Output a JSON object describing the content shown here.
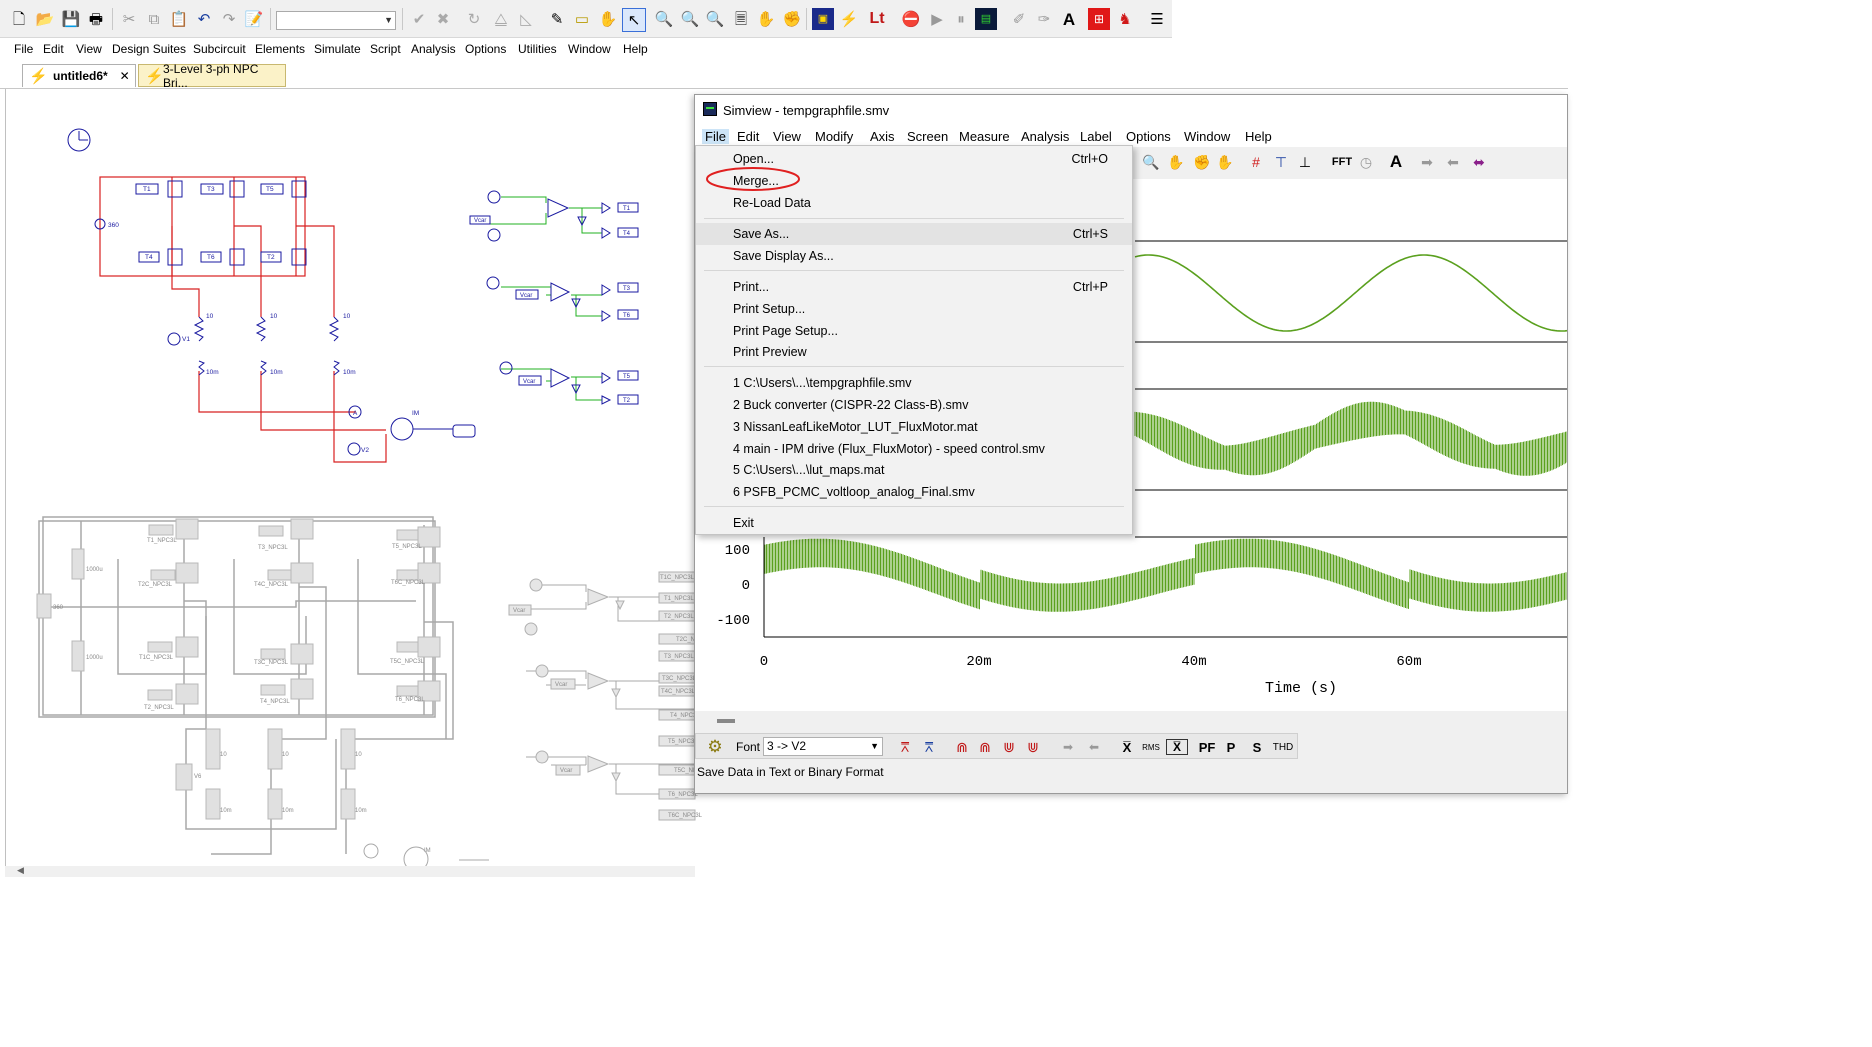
{
  "main_window": {
    "menus": [
      "File",
      "Edit",
      "View",
      "Design Suites",
      "Subcircuit",
      "Elements",
      "Simulate",
      "Script",
      "Analysis",
      "Options",
      "Utilities",
      "Window",
      "Help"
    ],
    "tabs": [
      {
        "label": "untitled6*",
        "close": "✕"
      },
      {
        "label": "3-Level 3-ph NPC Bri..."
      }
    ],
    "toolbar_icons": [
      "new-file",
      "open-folder",
      "save",
      "print",
      "cut",
      "copy",
      "paste",
      "undo",
      "redo",
      "clipboard",
      "check",
      "cross",
      "rotate",
      "flip",
      "mirror",
      "pencil",
      "label",
      "hand",
      "select-arrow",
      "zoom",
      "zoom-in",
      "zoom-out",
      "page",
      "hand-pan",
      "hand-grab",
      "simview",
      "wand",
      "lt",
      "stop",
      "run",
      "pause",
      "scope",
      "pen-probe",
      "pen-probe2",
      "text",
      "plot-icon",
      "redbull-icon",
      "list"
    ]
  },
  "schematic": {
    "labels": {
      "dc_source": "360",
      "dc_source2": "360",
      "sw": [
        "T1",
        "T3",
        "T5",
        "T4",
        "T6",
        "T2"
      ],
      "r": "10",
      "l": "10m",
      "v1": "V1",
      "v2": "V2",
      "im": "IM",
      "a": "A",
      "vcar": "Vcar",
      "g_out": [
        "T1",
        "T4",
        "T3",
        "T6",
        "T5",
        "T2"
      ],
      "npc_sw": [
        "T1_NPC3L",
        "T3_NPC3L",
        "T5_NPC3L",
        "T2C_NPC3L",
        "T4C_NPC3L",
        "T6C_NPC3L",
        "T1C_NPC3L",
        "T3C_NPC3L",
        "T5C_NPC3L",
        "T2_NPC3L",
        "T4_NPC3L",
        "T6_NPC3L"
      ],
      "cap": "1000u",
      "v6": "V6",
      "npc_g": [
        "T1C_NPC3L",
        "T1_NPC3L",
        "T2_NPC3L",
        "T2C_NPC3L",
        "T3_NPC3L",
        "T3C_NPC3L",
        "T4C_NPC3L",
        "T4_NPC3L",
        "T5_NPC3L",
        "T5C_NPC3L",
        "T6_NPC3L",
        "T6C_NPC3L"
      ]
    }
  },
  "simview": {
    "title": "Simview - tempgraphfile.smv",
    "menus": [
      "File",
      "Edit",
      "View",
      "Modify",
      "Axis",
      "Screen",
      "Measure",
      "Analysis",
      "Label",
      "Options",
      "Window",
      "Help"
    ],
    "toolbar_labels": {
      "fft": "FFT",
      "text": "A"
    },
    "file_menu": {
      "items": [
        {
          "label": "Open...",
          "shortcut": "Ctrl+O"
        },
        {
          "label": "Merge...",
          "shortcut": ""
        },
        {
          "label": "Re-Load Data",
          "shortcut": ""
        },
        {
          "label": "Save As...",
          "shortcut": "Ctrl+S"
        },
        {
          "label": "Save Display As...",
          "shortcut": ""
        },
        {
          "label": "Print...",
          "shortcut": "Ctrl+P"
        },
        {
          "label": "Print Setup...",
          "shortcut": ""
        },
        {
          "label": "Print Page Setup...",
          "shortcut": ""
        },
        {
          "label": "Print Preview",
          "shortcut": ""
        },
        {
          "label": "1 C:\\Users\\...\\tempgraphfile.smv",
          "shortcut": ""
        },
        {
          "label": "2 Buck converter (CISPR-22 Class-B).smv",
          "shortcut": ""
        },
        {
          "label": "3 NissanLeafLikeMotor_LUT_FluxMotor.mat",
          "shortcut": ""
        },
        {
          "label": "4 main - IPM drive (Flux_FluxMotor) - speed control.smv",
          "shortcut": ""
        },
        {
          "label": "5 C:\\Users\\...\\lut_maps.mat",
          "shortcut": ""
        },
        {
          "label": "6 PSFB_PCMC_voltloop_analog_Final.smv",
          "shortcut": ""
        },
        {
          "label": "Exit",
          "shortcut": ""
        }
      ]
    },
    "plot": {
      "y_ticks": [
        "100",
        "0",
        "-100"
      ],
      "x_ticks": [
        "0",
        "20m",
        "40m",
        "60m"
      ],
      "x_label": "Time (s)"
    },
    "bottom_toolbar": {
      "font": "Font",
      "trace": "3 -> V2",
      "x_bar": "X̅",
      "rms": "RMS",
      "pf": "PF",
      "p": "P",
      "s": "S",
      "thd": "THD"
    },
    "status": "Save Data in Text or Binary Format"
  },
  "annotation_colors": {
    "highlight": "#f5f000",
    "circle": "#e02020",
    "trace": "#5aa01e"
  }
}
